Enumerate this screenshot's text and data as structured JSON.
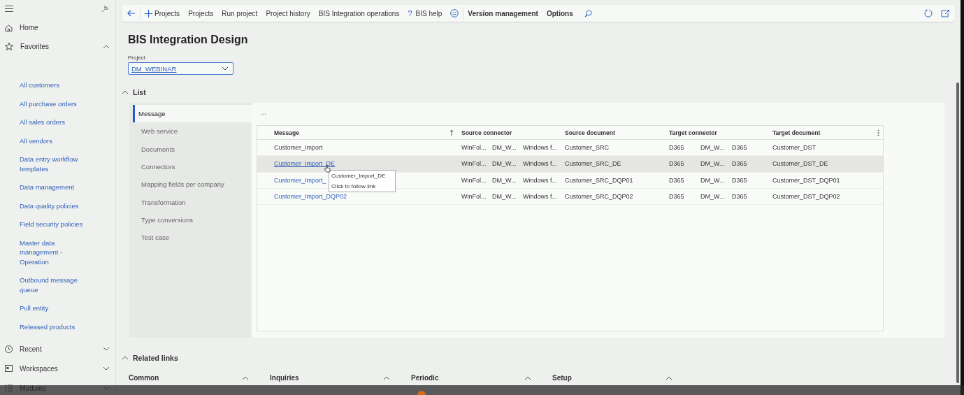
{
  "sidebar": {
    "home": "Home",
    "favorites": {
      "label": "Favorites",
      "expanded": true,
      "items": [
        "All customers",
        "All purchase orders",
        "All sales orders",
        "All vendors",
        "Data entry workflow templates",
        "Data management",
        "Data quality policies",
        "Field security policies",
        "Master data management - Operation",
        "Outbound message queue",
        "Pull entity",
        "Released products"
      ]
    },
    "groups": [
      {
        "label": "Recent",
        "expanded": false
      },
      {
        "label": "Workspaces",
        "expanded": false
      },
      {
        "label": "Modules",
        "expanded": false
      }
    ]
  },
  "toolbar": {
    "new_label": "Projects",
    "actions": [
      "Projects",
      "Run project",
      "Project history",
      "BIS Integration operations"
    ],
    "help": {
      "glyph": "?",
      "label": "BIS help"
    },
    "bold_actions": [
      "Version management",
      "Options"
    ]
  },
  "page": {
    "title": "BIS Integration Design",
    "project": {
      "label": "Project",
      "value": "DM_WEBINAR"
    }
  },
  "list": {
    "title": "List",
    "expanded": true,
    "tabs": [
      {
        "label": "Message",
        "selected": true
      },
      {
        "label": "Web service",
        "selected": false
      },
      {
        "label": "Documents",
        "selected": false
      },
      {
        "label": "Connectors",
        "selected": false
      },
      {
        "label": "Mapping fields per company",
        "selected": false
      },
      {
        "label": "Transformation",
        "selected": false
      },
      {
        "label": "Type conversions",
        "selected": false
      },
      {
        "label": "Test case",
        "selected": false
      }
    ],
    "more": "...",
    "table": {
      "columns": [
        "Message",
        "Source connector",
        "Source document",
        "Target connector",
        "Target document"
      ],
      "rows": [
        {
          "message": "Customer_Import",
          "link": false,
          "selected": false,
          "source_connector": [
            "WinFol...",
            "DM_W...",
            "Windows f..."
          ],
          "source_document": "Customer_SRC",
          "target_connector": [
            "D365",
            "DM_W...",
            "D365"
          ],
          "target_document": "Customer_DST"
        },
        {
          "message": "Customer_Import_DE",
          "link": true,
          "selected": true,
          "source_connector": [
            "WinFol...",
            "DM_W...",
            "Windows f..."
          ],
          "source_document": "Customer_SRC_DE",
          "target_connector": [
            "D365",
            "DM_W...",
            "D365"
          ],
          "target_document": "Customer_DST_DE"
        },
        {
          "message": "Customer_Import_",
          "link": true,
          "selected": false,
          "source_connector": [
            "WinFol...",
            "DM_W...",
            "Windows f..."
          ],
          "source_document": "Customer_SRC_DQP01",
          "target_connector": [
            "D365",
            "DM_W...",
            "D365"
          ],
          "target_document": "Customer_DST_DQP01"
        },
        {
          "message": "Customer_Import_DQP02",
          "link": true,
          "selected": false,
          "source_connector": [
            "WinFol...",
            "DM_W...",
            "Windows f..."
          ],
          "source_document": "Customer_SRC_DQP02",
          "target_connector": [
            "D365",
            "DM_W...",
            "D365"
          ],
          "target_document": "Customer_DST_DQP02"
        }
      ]
    },
    "tooltip": {
      "title": "Customer_Import_DE",
      "hint": "Click to follow link"
    }
  },
  "related": {
    "title": "Related links",
    "expanded": true,
    "sections": [
      {
        "label": "Common",
        "expanded": true
      },
      {
        "label": "Inquiries",
        "expanded": true
      },
      {
        "label": "Periodic",
        "expanded": true
      },
      {
        "label": "Setup",
        "expanded": true
      }
    ]
  }
}
